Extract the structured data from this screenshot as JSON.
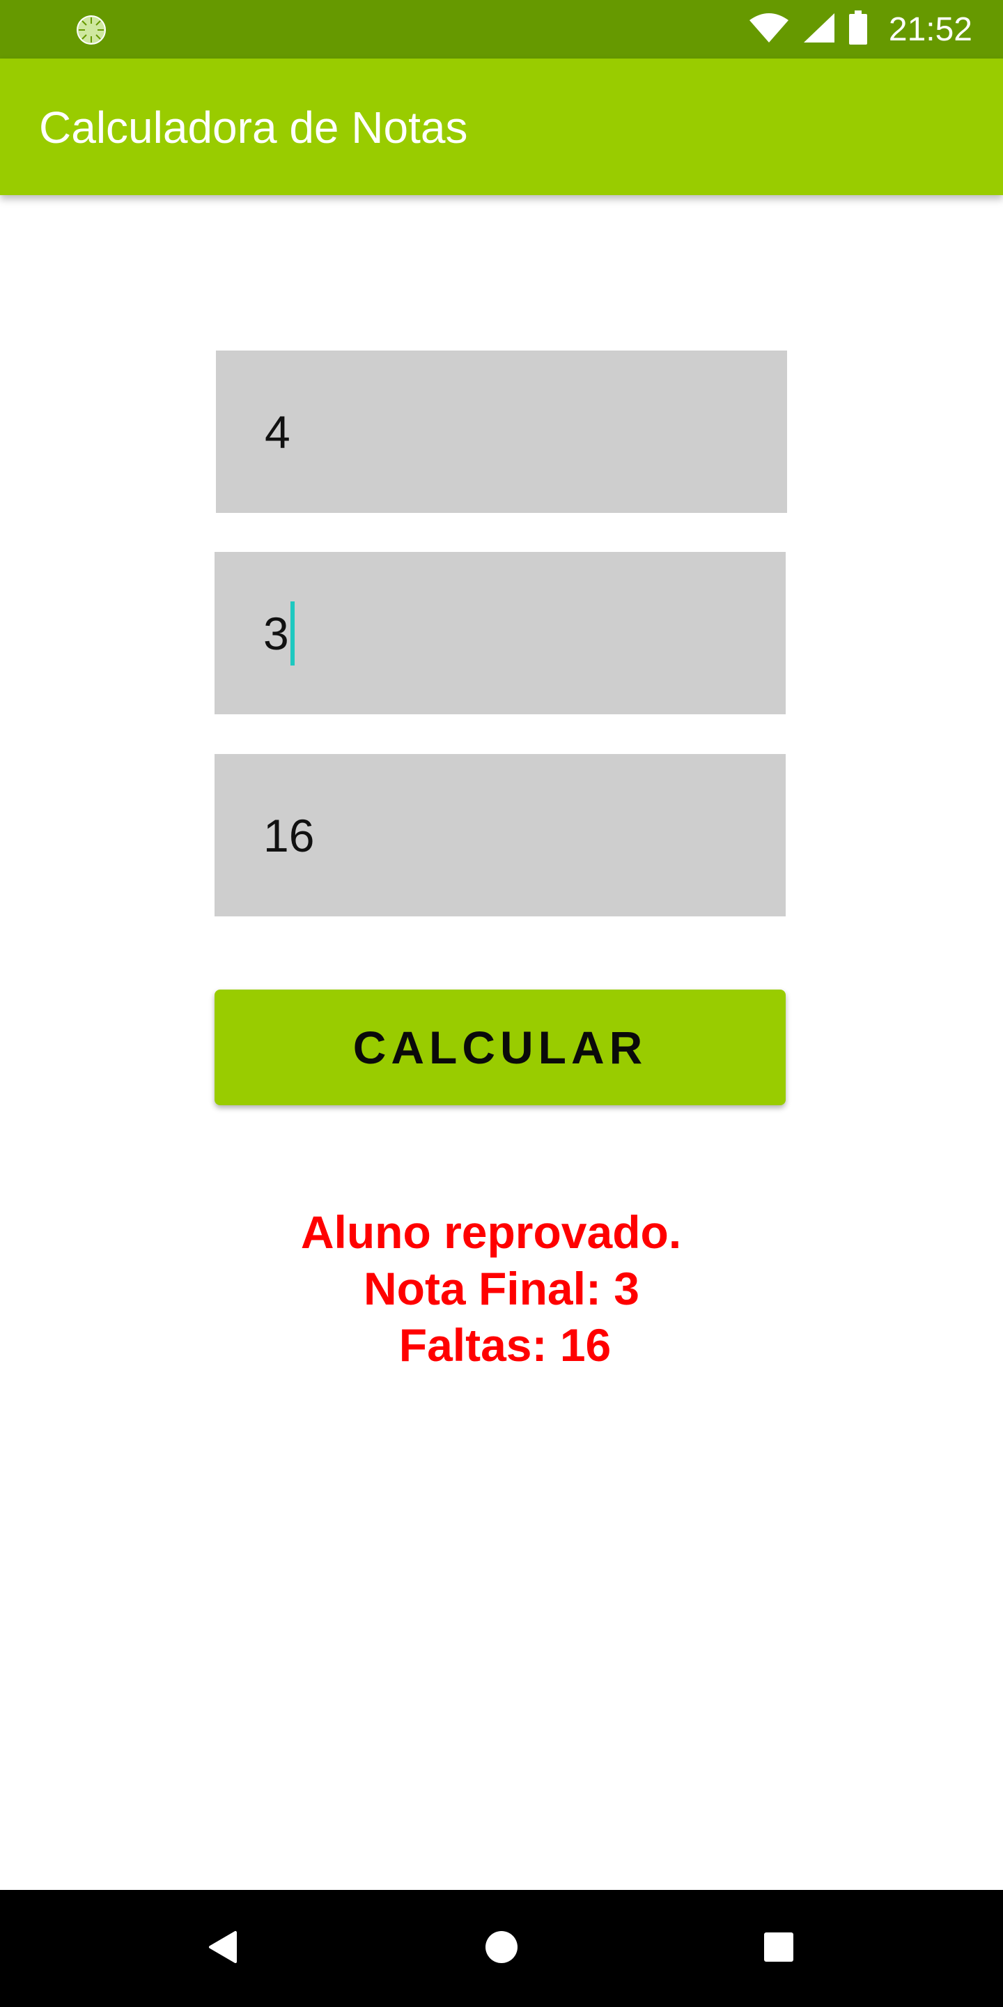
{
  "status_bar": {
    "time": "21:52",
    "left_icon": "loading-indicator-icon",
    "icons": [
      "wifi-icon",
      "signal-icon",
      "battery-icon"
    ]
  },
  "app_bar": {
    "title": "Calculadora de Notas"
  },
  "form": {
    "input_1_value": "4",
    "input_2_value": "3",
    "input_3_value": "16",
    "button_label": "CALCULAR"
  },
  "result": {
    "line_1": "Aluno reprovado.",
    "line_2": "Nota Final: 3",
    "line_3": "Faltas: 16"
  },
  "nav_bar": {
    "icons": [
      "back-icon",
      "home-icon",
      "recents-icon"
    ]
  },
  "colors": {
    "status_bar": "#669900",
    "app_bar": "#99cc00",
    "button": "#99cc00",
    "input_background": "#cecece",
    "result_text": "#ff0000",
    "caret": "#1ec8c0"
  }
}
